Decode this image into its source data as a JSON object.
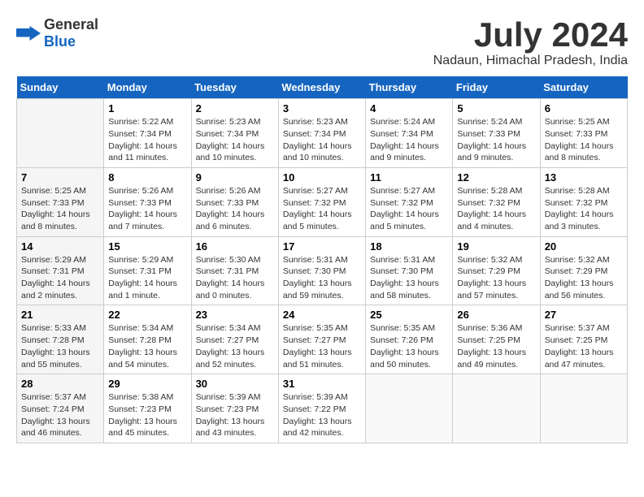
{
  "header": {
    "logo_general": "General",
    "logo_blue": "Blue",
    "month_title": "July 2024",
    "location": "Nadaun, Himachal Pradesh, India"
  },
  "weekdays": [
    "Sunday",
    "Monday",
    "Tuesday",
    "Wednesday",
    "Thursday",
    "Friday",
    "Saturday"
  ],
  "weeks": [
    [
      {
        "day": "",
        "info": ""
      },
      {
        "day": "1",
        "info": "Sunrise: 5:22 AM\nSunset: 7:34 PM\nDaylight: 14 hours\nand 11 minutes."
      },
      {
        "day": "2",
        "info": "Sunrise: 5:23 AM\nSunset: 7:34 PM\nDaylight: 14 hours\nand 10 minutes."
      },
      {
        "day": "3",
        "info": "Sunrise: 5:23 AM\nSunset: 7:34 PM\nDaylight: 14 hours\nand 10 minutes."
      },
      {
        "day": "4",
        "info": "Sunrise: 5:24 AM\nSunset: 7:34 PM\nDaylight: 14 hours\nand 9 minutes."
      },
      {
        "day": "5",
        "info": "Sunrise: 5:24 AM\nSunset: 7:33 PM\nDaylight: 14 hours\nand 9 minutes."
      },
      {
        "day": "6",
        "info": "Sunrise: 5:25 AM\nSunset: 7:33 PM\nDaylight: 14 hours\nand 8 minutes."
      }
    ],
    [
      {
        "day": "7",
        "info": "Sunrise: 5:25 AM\nSunset: 7:33 PM\nDaylight: 14 hours\nand 8 minutes."
      },
      {
        "day": "8",
        "info": "Sunrise: 5:26 AM\nSunset: 7:33 PM\nDaylight: 14 hours\nand 7 minutes."
      },
      {
        "day": "9",
        "info": "Sunrise: 5:26 AM\nSunset: 7:33 PM\nDaylight: 14 hours\nand 6 minutes."
      },
      {
        "day": "10",
        "info": "Sunrise: 5:27 AM\nSunset: 7:32 PM\nDaylight: 14 hours\nand 5 minutes."
      },
      {
        "day": "11",
        "info": "Sunrise: 5:27 AM\nSunset: 7:32 PM\nDaylight: 14 hours\nand 5 minutes."
      },
      {
        "day": "12",
        "info": "Sunrise: 5:28 AM\nSunset: 7:32 PM\nDaylight: 14 hours\nand 4 minutes."
      },
      {
        "day": "13",
        "info": "Sunrise: 5:28 AM\nSunset: 7:32 PM\nDaylight: 14 hours\nand 3 minutes."
      }
    ],
    [
      {
        "day": "14",
        "info": "Sunrise: 5:29 AM\nSunset: 7:31 PM\nDaylight: 14 hours\nand 2 minutes."
      },
      {
        "day": "15",
        "info": "Sunrise: 5:29 AM\nSunset: 7:31 PM\nDaylight: 14 hours\nand 1 minute."
      },
      {
        "day": "16",
        "info": "Sunrise: 5:30 AM\nSunset: 7:31 PM\nDaylight: 14 hours\nand 0 minutes."
      },
      {
        "day": "17",
        "info": "Sunrise: 5:31 AM\nSunset: 7:30 PM\nDaylight: 13 hours\nand 59 minutes."
      },
      {
        "day": "18",
        "info": "Sunrise: 5:31 AM\nSunset: 7:30 PM\nDaylight: 13 hours\nand 58 minutes."
      },
      {
        "day": "19",
        "info": "Sunrise: 5:32 AM\nSunset: 7:29 PM\nDaylight: 13 hours\nand 57 minutes."
      },
      {
        "day": "20",
        "info": "Sunrise: 5:32 AM\nSunset: 7:29 PM\nDaylight: 13 hours\nand 56 minutes."
      }
    ],
    [
      {
        "day": "21",
        "info": "Sunrise: 5:33 AM\nSunset: 7:28 PM\nDaylight: 13 hours\nand 55 minutes."
      },
      {
        "day": "22",
        "info": "Sunrise: 5:34 AM\nSunset: 7:28 PM\nDaylight: 13 hours\nand 54 minutes."
      },
      {
        "day": "23",
        "info": "Sunrise: 5:34 AM\nSunset: 7:27 PM\nDaylight: 13 hours\nand 52 minutes."
      },
      {
        "day": "24",
        "info": "Sunrise: 5:35 AM\nSunset: 7:27 PM\nDaylight: 13 hours\nand 51 minutes."
      },
      {
        "day": "25",
        "info": "Sunrise: 5:35 AM\nSunset: 7:26 PM\nDaylight: 13 hours\nand 50 minutes."
      },
      {
        "day": "26",
        "info": "Sunrise: 5:36 AM\nSunset: 7:25 PM\nDaylight: 13 hours\nand 49 minutes."
      },
      {
        "day": "27",
        "info": "Sunrise: 5:37 AM\nSunset: 7:25 PM\nDaylight: 13 hours\nand 47 minutes."
      }
    ],
    [
      {
        "day": "28",
        "info": "Sunrise: 5:37 AM\nSunset: 7:24 PM\nDaylight: 13 hours\nand 46 minutes."
      },
      {
        "day": "29",
        "info": "Sunrise: 5:38 AM\nSunset: 7:23 PM\nDaylight: 13 hours\nand 45 minutes."
      },
      {
        "day": "30",
        "info": "Sunrise: 5:39 AM\nSunset: 7:23 PM\nDaylight: 13 hours\nand 43 minutes."
      },
      {
        "day": "31",
        "info": "Sunrise: 5:39 AM\nSunset: 7:22 PM\nDaylight: 13 hours\nand 42 minutes."
      },
      {
        "day": "",
        "info": ""
      },
      {
        "day": "",
        "info": ""
      },
      {
        "day": "",
        "info": ""
      }
    ]
  ]
}
